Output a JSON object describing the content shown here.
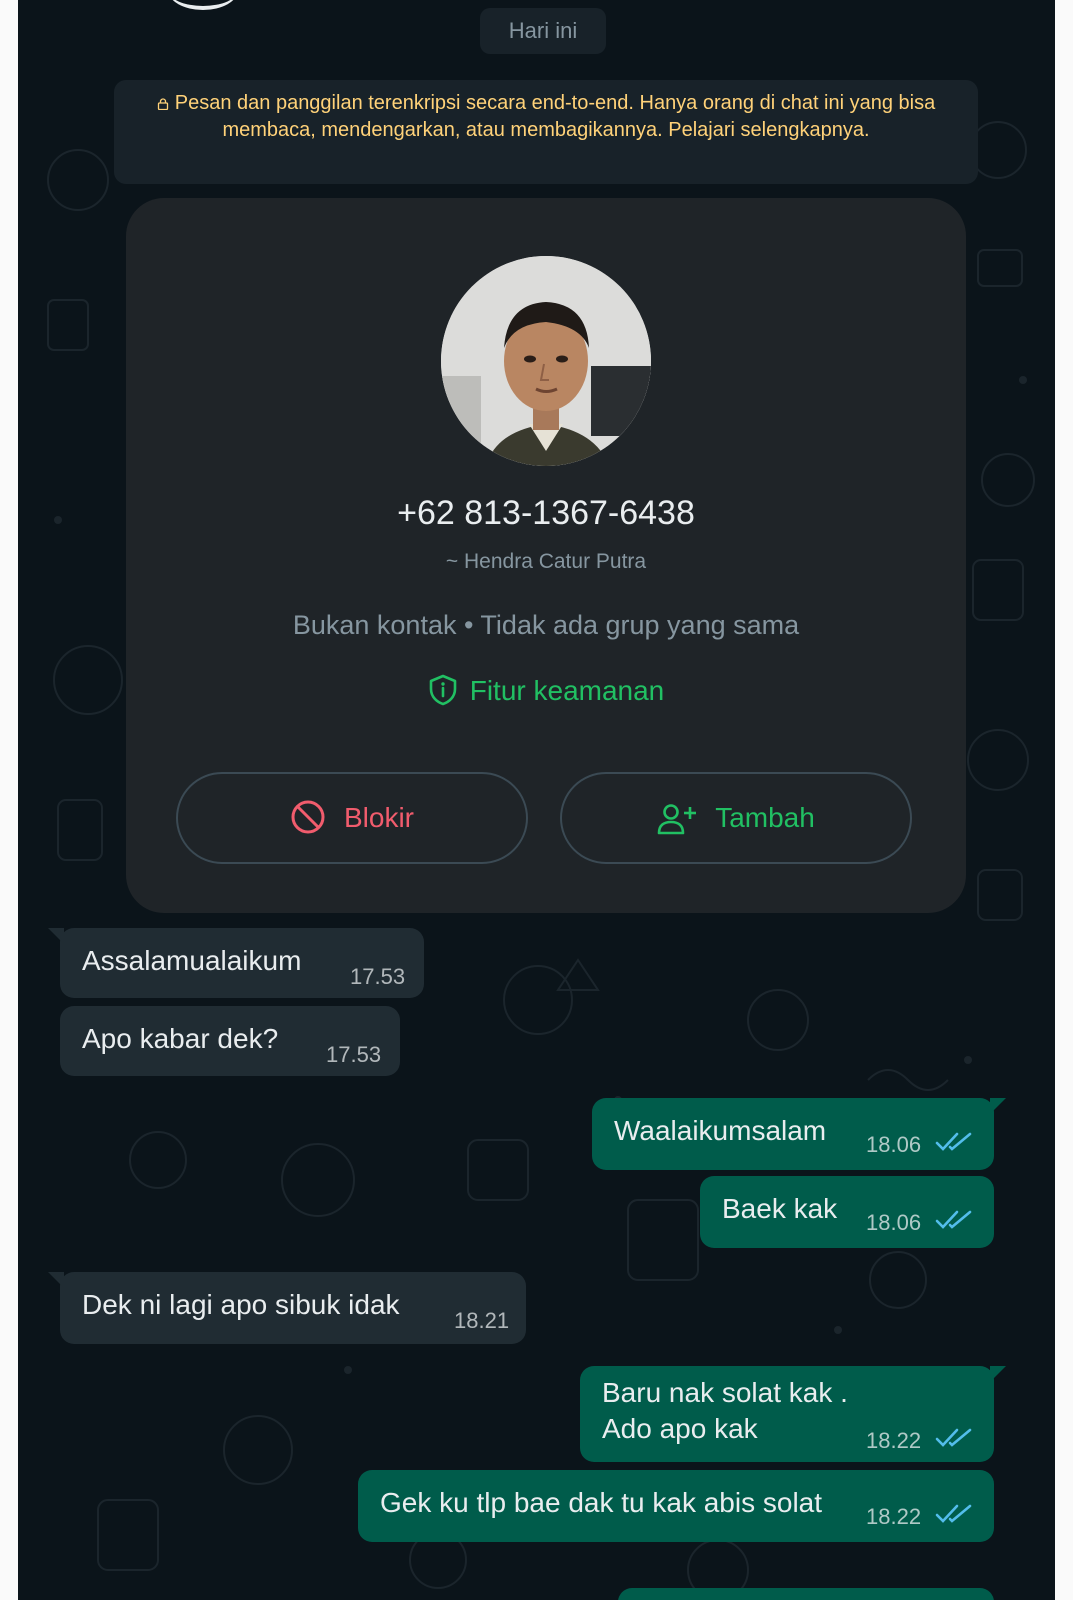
{
  "date_chip": "Hari ini",
  "encryption_notice": "Pesan dan panggilan terenkripsi secara end-to-end. Hanya orang di chat ini yang bisa membaca, mendengarkan, atau membagikannya. Pelajari selengkapnya.",
  "contact_card": {
    "phone_number": "+62 813-1367-6438",
    "push_name": "~ Hendra Catur Putra",
    "meta": "Bukan kontak • Tidak ada grup yang sama",
    "security_label": "Fitur keamanan",
    "block_label": "Blokir",
    "add_label": "Tambah"
  },
  "messages": [
    {
      "direction": "in",
      "text": "Assalamualaikum",
      "time": "17.53"
    },
    {
      "direction": "in",
      "text": "Apo kabar dek?",
      "time": "17.53"
    },
    {
      "direction": "out",
      "text": "Waalaikumsalam",
      "time": "18.06",
      "status": "read"
    },
    {
      "direction": "out",
      "text": "Baek kak",
      "time": "18.06",
      "status": "read"
    },
    {
      "direction": "in",
      "text": "Dek ni lagi apo sibuk idak",
      "time": "18.21"
    },
    {
      "direction": "out",
      "text_line1": "Baru nak solat kak .",
      "text_line2": "Ado apo kak",
      "time": "18.22",
      "status": "read"
    },
    {
      "direction": "out",
      "text": "Gek ku tlp bae dak tu kak abis solat",
      "time": "18.22",
      "status": "read"
    }
  ],
  "colors": {
    "chat_background": "#0b141a",
    "incoming_bubble": "#202c33",
    "outgoing_bubble": "#005c4b",
    "accent_green": "#21c063",
    "danger_red": "#f15c6d",
    "notice_yellow": "#ffd279",
    "read_tick_blue": "#53bdeb"
  },
  "icons": [
    "lock-icon",
    "shield-icon",
    "block-icon",
    "add-person-icon",
    "double-check-icon"
  ]
}
